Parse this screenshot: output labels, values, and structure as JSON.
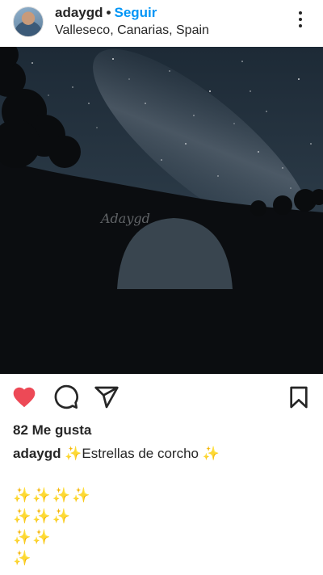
{
  "post": {
    "username": "adaygd",
    "separator": "•",
    "follow_label": "Seguir",
    "location": "Valleseco, Canarias, Spain",
    "watermark": "Adaygd"
  },
  "icons": {
    "avatar": "user-avatar",
    "more": "more-vertical-icon",
    "like": "heart-filled-icon",
    "comment": "comment-icon",
    "share": "send-icon",
    "save": "bookmark-icon"
  },
  "colors": {
    "like": "#ed4956",
    "follow": "#0095f6",
    "text": "#262626",
    "sparkle": "#f0c030"
  },
  "engagement": {
    "likes_text": "82 Me gusta"
  },
  "caption": {
    "username": "adaygd",
    "text": " ✨Estrellas de corcho ✨"
  },
  "sparkle_rows": [
    "✨✨✨✨",
    "✨✨✨",
    "✨✨",
    "✨"
  ]
}
